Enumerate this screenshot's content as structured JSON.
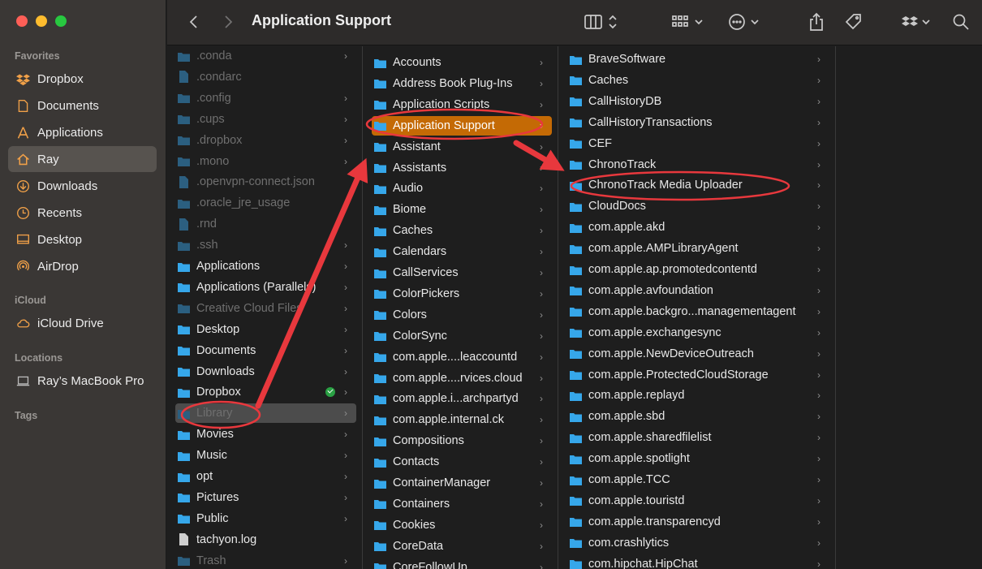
{
  "window": {
    "title": "Application Support"
  },
  "sidebar": {
    "favorites_header": "Favorites",
    "favorites": [
      {
        "label": "Dropbox",
        "icon": "dropbox-icon"
      },
      {
        "label": "Documents",
        "icon": "document-icon"
      },
      {
        "label": "Applications",
        "icon": "applications-icon"
      },
      {
        "label": "Ray",
        "icon": "home-icon",
        "selected": true
      },
      {
        "label": "Downloads",
        "icon": "download-icon"
      },
      {
        "label": "Recents",
        "icon": "clock-icon"
      },
      {
        "label": "Desktop",
        "icon": "desktop-icon"
      },
      {
        "label": "AirDrop",
        "icon": "airdrop-icon"
      }
    ],
    "icloud_header": "iCloud",
    "icloud": [
      {
        "label": "iCloud Drive",
        "icon": "cloud-icon"
      }
    ],
    "locations_header": "Locations",
    "locations": [
      {
        "label": "Ray’s MacBook Pro",
        "icon": "laptop-icon"
      }
    ],
    "tags_header": "Tags"
  },
  "colors": {
    "accent_orange": "#c46a05",
    "annotation_red": "#e8383d",
    "folder_blue": "#36a7ea"
  },
  "column1": [
    {
      "name": ".conda",
      "type": "folder",
      "dim": true,
      "chevron": true
    },
    {
      "name": ".condarc",
      "type": "file",
      "dim": true,
      "chevron": false
    },
    {
      "name": ".config",
      "type": "folder",
      "dim": true,
      "chevron": true
    },
    {
      "name": ".cups",
      "type": "folder",
      "dim": true,
      "chevron": true
    },
    {
      "name": ".dropbox",
      "type": "folder",
      "dim": true,
      "chevron": true
    },
    {
      "name": ".mono",
      "type": "folder",
      "dim": true,
      "chevron": true
    },
    {
      "name": ".openvpn-connect.json",
      "type": "file",
      "dim": true,
      "chevron": false
    },
    {
      "name": ".oracle_jre_usage",
      "type": "folder",
      "dim": true,
      "chevron": true
    },
    {
      "name": ".rnd",
      "type": "file",
      "dim": true,
      "chevron": false
    },
    {
      "name": ".ssh",
      "type": "folder",
      "dim": true,
      "chevron": true
    },
    {
      "name": "Applications",
      "type": "folder",
      "dim": false,
      "chevron": true
    },
    {
      "name": "Applications (Parallels)",
      "type": "folder",
      "dim": false,
      "chevron": true
    },
    {
      "name": "Creative Cloud Files",
      "type": "folder",
      "dim": true,
      "chevron": true
    },
    {
      "name": "Desktop",
      "type": "folder",
      "dim": false,
      "chevron": true
    },
    {
      "name": "Documents",
      "type": "folder",
      "dim": false,
      "chevron": true
    },
    {
      "name": "Downloads",
      "type": "folder",
      "dim": false,
      "chevron": true
    },
    {
      "name": "Dropbox",
      "type": "folder",
      "dim": false,
      "chevron": true,
      "badge": true
    },
    {
      "name": "Library",
      "type": "folder",
      "dim": true,
      "chevron": true,
      "selected": true
    },
    {
      "name": "Movies",
      "type": "folder",
      "dim": false,
      "chevron": true
    },
    {
      "name": "Music",
      "type": "folder",
      "dim": false,
      "chevron": true
    },
    {
      "name": "opt",
      "type": "folder",
      "dim": false,
      "chevron": true
    },
    {
      "name": "Pictures",
      "type": "folder",
      "dim": false,
      "chevron": true
    },
    {
      "name": "Public",
      "type": "folder",
      "dim": false,
      "chevron": true
    },
    {
      "name": "tachyon.log",
      "type": "file",
      "dim": false,
      "chevron": false
    },
    {
      "name": "Trash",
      "type": "folder",
      "dim": true,
      "chevron": true
    }
  ],
  "column2": [
    {
      "name": "Accounts"
    },
    {
      "name": "Address Book Plug-Ins"
    },
    {
      "name": "Application Scripts"
    },
    {
      "name": "Application Support",
      "selected": true
    },
    {
      "name": "Assistant"
    },
    {
      "name": "Assistants"
    },
    {
      "name": "Audio"
    },
    {
      "name": "Biome"
    },
    {
      "name": "Caches"
    },
    {
      "name": "Calendars"
    },
    {
      "name": "CallServices"
    },
    {
      "name": "ColorPickers"
    },
    {
      "name": "Colors"
    },
    {
      "name": "ColorSync"
    },
    {
      "name": "com.apple....leaccountd"
    },
    {
      "name": "com.apple....rvices.cloud"
    },
    {
      "name": "com.apple.i...archpartyd"
    },
    {
      "name": "com.apple.internal.ck"
    },
    {
      "name": "Compositions"
    },
    {
      "name": "Contacts"
    },
    {
      "name": "ContainerManager"
    },
    {
      "name": "Containers"
    },
    {
      "name": "Cookies"
    },
    {
      "name": "CoreData"
    },
    {
      "name": "CoreFollowUp"
    }
  ],
  "column3": [
    {
      "name": "BraveSoftware"
    },
    {
      "name": "Caches"
    },
    {
      "name": "CallHistoryDB"
    },
    {
      "name": "CallHistoryTransactions"
    },
    {
      "name": "CEF"
    },
    {
      "name": "ChronoTrack"
    },
    {
      "name": "ChronoTrack Media Uploader",
      "highlighted": true
    },
    {
      "name": "CloudDocs"
    },
    {
      "name": "com.apple.akd"
    },
    {
      "name": "com.apple.AMPLibraryAgent"
    },
    {
      "name": "com.apple.ap.promotedcontentd"
    },
    {
      "name": "com.apple.avfoundation"
    },
    {
      "name": "com.apple.backgro...managementagent"
    },
    {
      "name": "com.apple.exchangesync"
    },
    {
      "name": "com.apple.NewDeviceOutreach"
    },
    {
      "name": "com.apple.ProtectedCloudStorage"
    },
    {
      "name": "com.apple.replayd"
    },
    {
      "name": "com.apple.sbd"
    },
    {
      "name": "com.apple.sharedfilelist"
    },
    {
      "name": "com.apple.spotlight"
    },
    {
      "name": "com.apple.TCC"
    },
    {
      "name": "com.apple.touristd"
    },
    {
      "name": "com.apple.transparencyd"
    },
    {
      "name": "com.crashlytics"
    },
    {
      "name": "com.hipchat.HipChat"
    }
  ]
}
